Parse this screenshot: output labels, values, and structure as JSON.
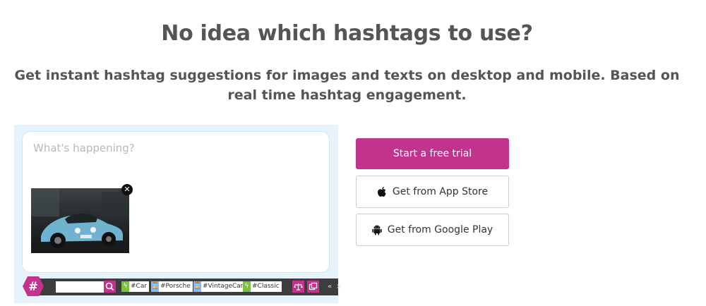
{
  "hero": {
    "headline": "No idea which hashtags to use?",
    "subhead": "Get instant hashtag suggestions for images and texts on desktop and mobile. Based on real time hashtag engagement."
  },
  "demo": {
    "placeholder": "What's happening?",
    "remove_icon": "close-icon",
    "toolbar": {
      "logo": "#",
      "search_icon": "search-icon",
      "tags": [
        {
          "label": "#Car",
          "icon": "bolt-icon",
          "color": "#7ac143"
        },
        {
          "label": "#Porsche",
          "icon": "hourglass-icon",
          "color": "#90b6e8"
        },
        {
          "label": "#VintageCar",
          "icon": "hourglass-icon",
          "color": "#90b6e8"
        },
        {
          "label": "#Classic",
          "icon": "bolt-icon",
          "color": "#7ac143"
        }
      ],
      "collapse": "«",
      "close": "×"
    }
  },
  "cta": {
    "trial": "Start a free trial",
    "app_store": "Get from App Store",
    "google_play": "Get from Google Play"
  },
  "colors": {
    "brand": "#c2338e",
    "text": "#555555",
    "panel_bg": "#e8f2fb",
    "toolbar_bg": "#3d3d3d"
  }
}
